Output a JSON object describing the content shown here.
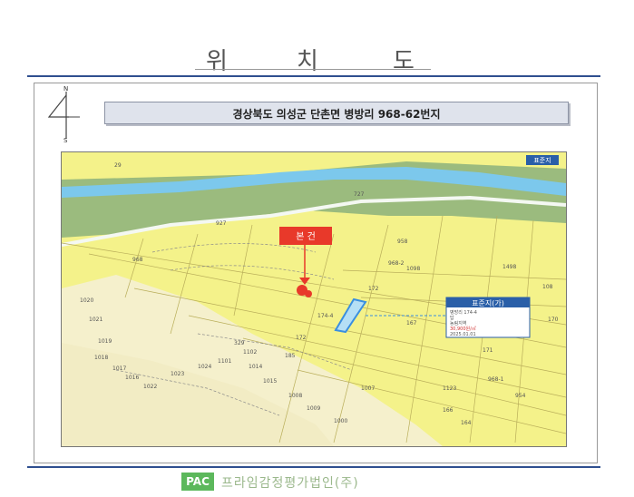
{
  "page": {
    "title_chars": [
      "위",
      "치",
      "도"
    ]
  },
  "compass": {
    "north": "N",
    "south": "S"
  },
  "address_label": "경상북도 의성군 단촌면 병방리 968-62번지",
  "map": {
    "corner_tag": "표준지",
    "subject_marker": "본 건",
    "reference_box": {
      "title": "표준지(가)",
      "lines": [
        "병방리 174-4",
        "답",
        "농림지역",
        "30,900원/㎡",
        "2025.01.01"
      ]
    },
    "parcel_labels": [
      "29",
      "927",
      "968",
      "958",
      "1098",
      "968-2",
      "172",
      "174-4",
      "172",
      "329",
      "171",
      "1498",
      "170",
      "1020",
      "1021",
      "1019",
      "1018",
      "1017",
      "1016",
      "1022",
      "1023",
      "1024",
      "1101",
      "1102",
      "1014",
      "1015",
      "1008",
      "1009",
      "1000",
      "1007",
      "185",
      "1123",
      "727",
      "167",
      "968-1",
      "954",
      "166",
      "164",
      "108"
    ],
    "colors": {
      "land": "#f4f28a",
      "forest": "#eef3c6",
      "river_band": "#9bbb7e",
      "river": "#7cc8ec",
      "marker": "#e8392a",
      "highlight": "#3a8fe0"
    }
  },
  "footer": {
    "logo": "PAC",
    "company": "프라임감정평가법인(주)"
  }
}
